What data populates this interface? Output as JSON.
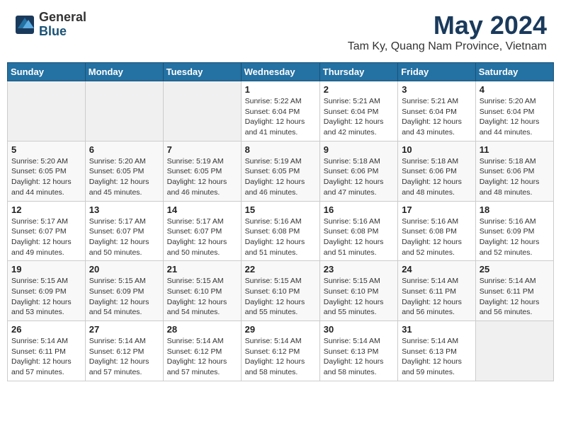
{
  "header": {
    "logo_general": "General",
    "logo_blue": "Blue",
    "month_title": "May 2024",
    "location": "Tam Ky, Quang Nam Province, Vietnam"
  },
  "days_of_week": [
    "Sunday",
    "Monday",
    "Tuesday",
    "Wednesday",
    "Thursday",
    "Friday",
    "Saturday"
  ],
  "weeks": [
    [
      {
        "day": "",
        "info": ""
      },
      {
        "day": "",
        "info": ""
      },
      {
        "day": "",
        "info": ""
      },
      {
        "day": "1",
        "info": "Sunrise: 5:22 AM\nSunset: 6:04 PM\nDaylight: 12 hours and 41 minutes."
      },
      {
        "day": "2",
        "info": "Sunrise: 5:21 AM\nSunset: 6:04 PM\nDaylight: 12 hours and 42 minutes."
      },
      {
        "day": "3",
        "info": "Sunrise: 5:21 AM\nSunset: 6:04 PM\nDaylight: 12 hours and 43 minutes."
      },
      {
        "day": "4",
        "info": "Sunrise: 5:20 AM\nSunset: 6:04 PM\nDaylight: 12 hours and 44 minutes."
      }
    ],
    [
      {
        "day": "5",
        "info": "Sunrise: 5:20 AM\nSunset: 6:05 PM\nDaylight: 12 hours and 44 minutes."
      },
      {
        "day": "6",
        "info": "Sunrise: 5:20 AM\nSunset: 6:05 PM\nDaylight: 12 hours and 45 minutes."
      },
      {
        "day": "7",
        "info": "Sunrise: 5:19 AM\nSunset: 6:05 PM\nDaylight: 12 hours and 46 minutes."
      },
      {
        "day": "8",
        "info": "Sunrise: 5:19 AM\nSunset: 6:05 PM\nDaylight: 12 hours and 46 minutes."
      },
      {
        "day": "9",
        "info": "Sunrise: 5:18 AM\nSunset: 6:06 PM\nDaylight: 12 hours and 47 minutes."
      },
      {
        "day": "10",
        "info": "Sunrise: 5:18 AM\nSunset: 6:06 PM\nDaylight: 12 hours and 48 minutes."
      },
      {
        "day": "11",
        "info": "Sunrise: 5:18 AM\nSunset: 6:06 PM\nDaylight: 12 hours and 48 minutes."
      }
    ],
    [
      {
        "day": "12",
        "info": "Sunrise: 5:17 AM\nSunset: 6:07 PM\nDaylight: 12 hours and 49 minutes."
      },
      {
        "day": "13",
        "info": "Sunrise: 5:17 AM\nSunset: 6:07 PM\nDaylight: 12 hours and 50 minutes."
      },
      {
        "day": "14",
        "info": "Sunrise: 5:17 AM\nSunset: 6:07 PM\nDaylight: 12 hours and 50 minutes."
      },
      {
        "day": "15",
        "info": "Sunrise: 5:16 AM\nSunset: 6:08 PM\nDaylight: 12 hours and 51 minutes."
      },
      {
        "day": "16",
        "info": "Sunrise: 5:16 AM\nSunset: 6:08 PM\nDaylight: 12 hours and 51 minutes."
      },
      {
        "day": "17",
        "info": "Sunrise: 5:16 AM\nSunset: 6:08 PM\nDaylight: 12 hours and 52 minutes."
      },
      {
        "day": "18",
        "info": "Sunrise: 5:16 AM\nSunset: 6:09 PM\nDaylight: 12 hours and 52 minutes."
      }
    ],
    [
      {
        "day": "19",
        "info": "Sunrise: 5:15 AM\nSunset: 6:09 PM\nDaylight: 12 hours and 53 minutes."
      },
      {
        "day": "20",
        "info": "Sunrise: 5:15 AM\nSunset: 6:09 PM\nDaylight: 12 hours and 54 minutes."
      },
      {
        "day": "21",
        "info": "Sunrise: 5:15 AM\nSunset: 6:10 PM\nDaylight: 12 hours and 54 minutes."
      },
      {
        "day": "22",
        "info": "Sunrise: 5:15 AM\nSunset: 6:10 PM\nDaylight: 12 hours and 55 minutes."
      },
      {
        "day": "23",
        "info": "Sunrise: 5:15 AM\nSunset: 6:10 PM\nDaylight: 12 hours and 55 minutes."
      },
      {
        "day": "24",
        "info": "Sunrise: 5:14 AM\nSunset: 6:11 PM\nDaylight: 12 hours and 56 minutes."
      },
      {
        "day": "25",
        "info": "Sunrise: 5:14 AM\nSunset: 6:11 PM\nDaylight: 12 hours and 56 minutes."
      }
    ],
    [
      {
        "day": "26",
        "info": "Sunrise: 5:14 AM\nSunset: 6:11 PM\nDaylight: 12 hours and 57 minutes."
      },
      {
        "day": "27",
        "info": "Sunrise: 5:14 AM\nSunset: 6:12 PM\nDaylight: 12 hours and 57 minutes."
      },
      {
        "day": "28",
        "info": "Sunrise: 5:14 AM\nSunset: 6:12 PM\nDaylight: 12 hours and 57 minutes."
      },
      {
        "day": "29",
        "info": "Sunrise: 5:14 AM\nSunset: 6:12 PM\nDaylight: 12 hours and 58 minutes."
      },
      {
        "day": "30",
        "info": "Sunrise: 5:14 AM\nSunset: 6:13 PM\nDaylight: 12 hours and 58 minutes."
      },
      {
        "day": "31",
        "info": "Sunrise: 5:14 AM\nSunset: 6:13 PM\nDaylight: 12 hours and 59 minutes."
      },
      {
        "day": "",
        "info": ""
      }
    ]
  ]
}
